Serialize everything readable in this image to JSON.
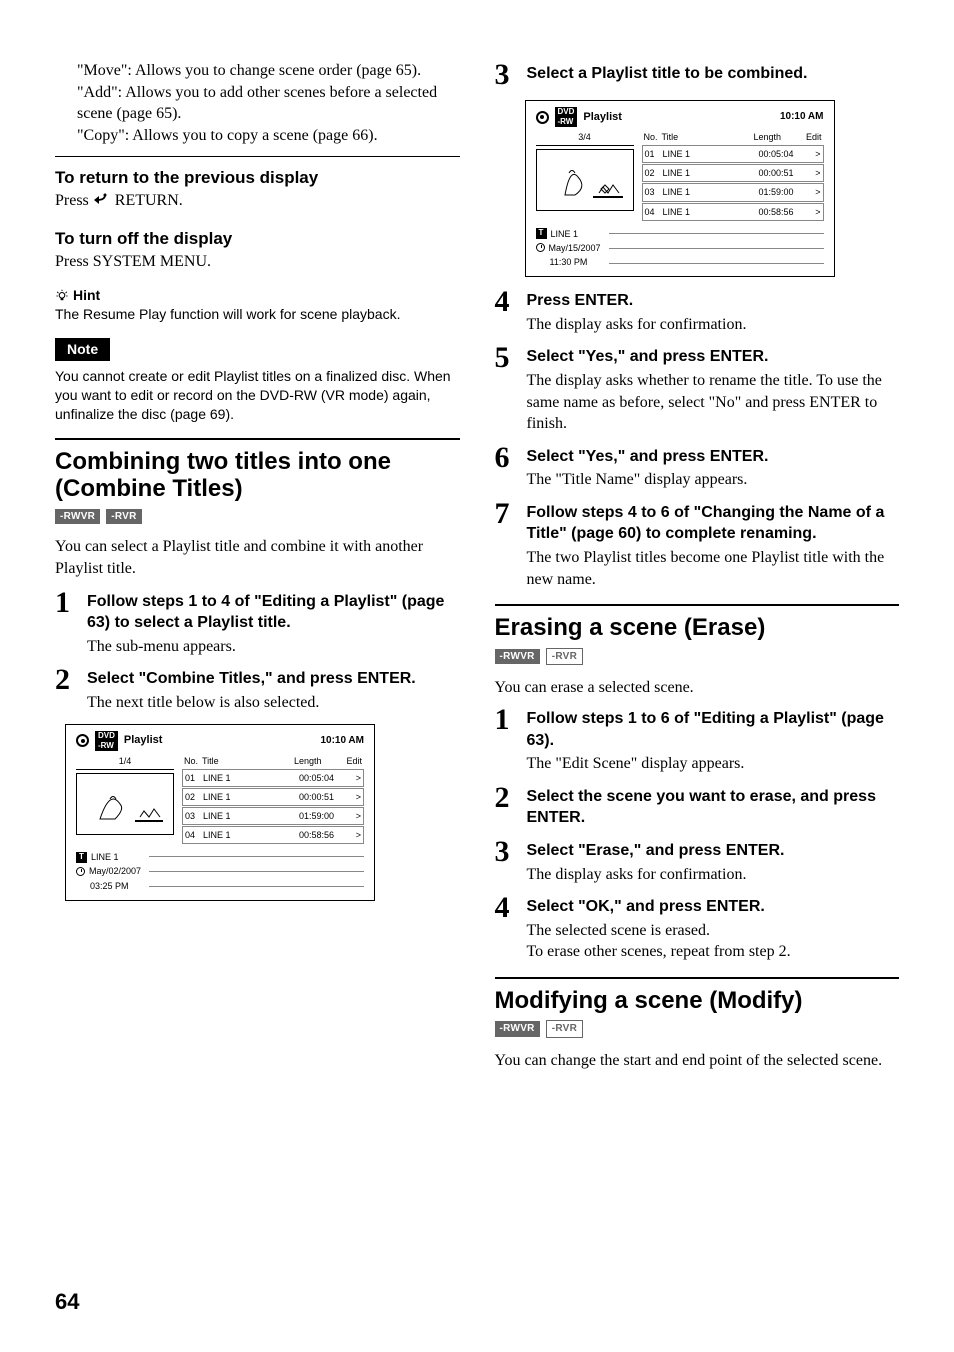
{
  "left": {
    "para_intro": [
      {
        "label": "\"Move\"",
        "text": ": Allows you to change scene order (page 65)."
      },
      {
        "label": "\"Add\"",
        "text": ": Allows you to add other scenes before a selected scene (page 65)."
      },
      {
        "label": "\"Copy\"",
        "text": ": Allows you to copy a scene (page 66)."
      }
    ],
    "return_heading": "To return to the previous display",
    "return_text_pre": "Press ",
    "return_text_post": " RETURN.",
    "turnoff_heading": "To turn off the display",
    "turnoff_text": "Press SYSTEM MENU.",
    "hint_label": "Hint",
    "hint_text": "The Resume Play function will work for scene playback.",
    "note_label": "Note",
    "note_text": "You cannot create or edit Playlist titles on a finalized disc. When you want to edit or record on the DVD-RW (VR mode) again, unfinalize the disc (page 69).",
    "combine_heading": "Combining two titles into one (Combine Titles)",
    "badge_rwvr": "-RWVR",
    "badge_rvr": "-RVR",
    "combine_intro": "You can select a Playlist title and combine it with another Playlist title.",
    "steps": [
      {
        "no": "1",
        "title": "Follow steps 1 to 4 of \"Editing a Playlist\" (page 63) to select a Playlist title.",
        "sub": "The sub-menu appears."
      },
      {
        "no": "2",
        "title": "Select \"Combine Titles,\" and press ENTER.",
        "sub": "The next title below is also selected."
      }
    ],
    "playlist": {
      "title": "Playlist",
      "time": "10:10 AM",
      "count": "1/4",
      "cols": {
        "no": "No.",
        "title": "Title",
        "length": "Length",
        "edit": "Edit"
      },
      "rows": [
        {
          "no": "01",
          "title": "LINE 1",
          "length": "00:05:04",
          "edit": ">"
        },
        {
          "no": "02",
          "title": "LINE 1",
          "length": "00:00:51",
          "edit": ">"
        },
        {
          "no": "03",
          "title": "LINE 1",
          "length": "01:59:00",
          "edit": ">"
        },
        {
          "no": "04",
          "title": "LINE 1",
          "length": "00:58:56",
          "edit": ">"
        }
      ],
      "meta_t": "LINE 1",
      "meta_date": "May/02/2007",
      "meta_time": "03:25  PM"
    }
  },
  "right": {
    "step3": {
      "no": "3",
      "title": "Select a Playlist title to be combined."
    },
    "playlist": {
      "title": "Playlist",
      "time": "10:10 AM",
      "count": "3/4",
      "cols": {
        "no": "No.",
        "title": "Title",
        "length": "Length",
        "edit": "Edit"
      },
      "rows": [
        {
          "no": "01",
          "title": "LINE 1",
          "length": "00:05:04",
          "edit": ">"
        },
        {
          "no": "02",
          "title": "LINE 1",
          "length": "00:00:51",
          "edit": ">"
        },
        {
          "no": "03",
          "title": "LINE 1",
          "length": "01:59:00",
          "edit": ">"
        },
        {
          "no": "04",
          "title": "LINE 1",
          "length": "00:58:56",
          "edit": ">"
        }
      ],
      "meta_t": "LINE 1",
      "meta_date": "May/15/2007",
      "meta_time": "11:30  PM"
    },
    "steps_after": [
      {
        "no": "4",
        "title": "Press ENTER.",
        "sub": "The display asks for confirmation."
      },
      {
        "no": "5",
        "title": "Select \"Yes,\" and press ENTER.",
        "sub": "The display asks whether to rename the title. To use the same name as before, select \"No\" and press ENTER to finish."
      },
      {
        "no": "6",
        "title": "Select \"Yes,\" and press ENTER.",
        "sub": "The \"Title Name\" display appears."
      },
      {
        "no": "7",
        "title": "Follow steps 4 to 6 of \"Changing the Name of a Title\" (page 60) to complete renaming.",
        "sub": "The two Playlist titles become one Playlist title with the new name."
      }
    ],
    "erase_heading": "Erasing a scene (Erase)",
    "badge_rwvr": "-RWVR",
    "badge_rvr": "-RVR",
    "erase_intro": "You can erase a selected scene.",
    "erase_steps": [
      {
        "no": "1",
        "title": "Follow steps 1 to 6 of \"Editing a Playlist\" (page 63).",
        "sub": "The \"Edit Scene\" display appears."
      },
      {
        "no": "2",
        "title": "Select the scene you want to erase, and press ENTER.",
        "sub": ""
      },
      {
        "no": "3",
        "title": "Select \"Erase,\" and press ENTER.",
        "sub": "The display asks for confirmation."
      },
      {
        "no": "4",
        "title": "Select \"OK,\" and press ENTER.",
        "sub": "The selected scene is erased.\nTo erase other scenes, repeat from step 2."
      }
    ],
    "modify_heading": "Modifying a scene (Modify)",
    "modify_intro": "You can change the start and end point of the selected scene."
  },
  "page_no": "64"
}
